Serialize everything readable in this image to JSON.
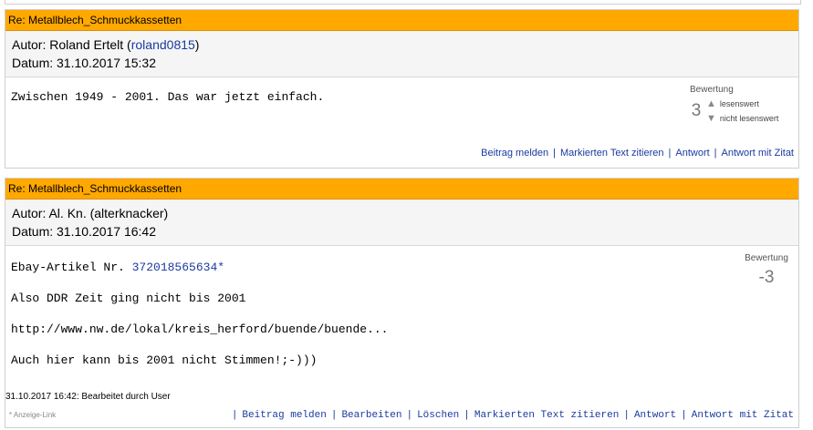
{
  "post1": {
    "title": "Re: Metallblech_Schmuckkassetten",
    "author_prefix": "Autor: Roland Ertelt (",
    "author_user": "roland0815",
    "author_suffix": ")",
    "date": "Datum: 31.10.2017 15:32",
    "body": "Zwischen 1949 - 2001. Das war jetzt einfach.",
    "rating_label": "Bewertung",
    "rating_score": "3",
    "vote_up": "lesenswert",
    "vote_down": "nicht lesenswert",
    "links": [
      "Beitrag melden",
      "Markierten Text zitieren",
      "Antwort",
      "Antwort mit Zitat"
    ]
  },
  "post2": {
    "title": "Re: Metallblech_Schmuckkassetten",
    "author_prefix": "Autor: Al. Kn. (",
    "author_user": "alterknacker",
    "author_suffix": ")",
    "date": "Datum: 31.10.2017 16:42",
    "line1_prefix": "Ebay-Artikel Nr. ",
    "line1_link": "372018565634*",
    "line2": "Also DDR Zeit ging nicht bis 2001",
    "line3": "http://www.nw.de/lokal/kreis_herford/buende/buende...",
    "line4": "Auch hier kann bis 2001 nicht Stimmen!;-)))",
    "rating_label": "Bewertung",
    "rating_score": "-3",
    "edit_note": "31.10.2017 16:42: Bearbeitet durch User",
    "ad_link": "* Anzeige-Link",
    "links": [
      "Beitrag melden",
      "Bearbeiten",
      "Löschen",
      "Markierten Text zitieren",
      "Antwort",
      "Antwort mit Zitat"
    ]
  },
  "colors": {
    "header": "#ffa800",
    "link": "#1a3aa0",
    "border": "#cfcfcf"
  },
  "icons": {
    "up": "triangle-up-icon",
    "down": "triangle-down-icon"
  }
}
